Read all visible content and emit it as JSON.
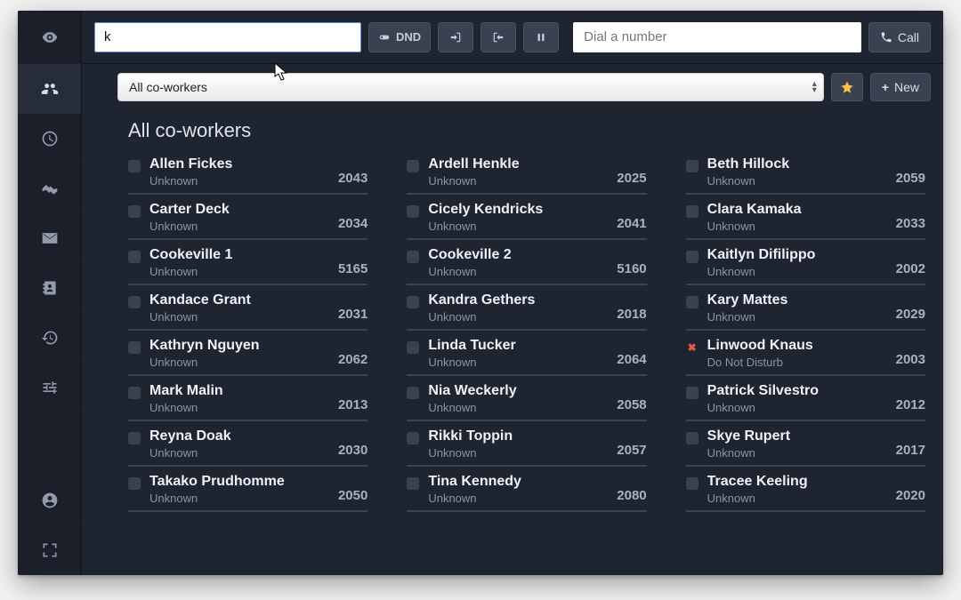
{
  "topbar": {
    "search_value": "k",
    "dnd_label": "DND",
    "dial_placeholder": "Dial a number",
    "call_label": "Call"
  },
  "filter": {
    "selected": "All co-workers",
    "new_label": "New"
  },
  "section": {
    "title": "All co-workers"
  },
  "status_labels": {
    "unknown": "Unknown",
    "dnd": "Do Not Disturb"
  },
  "contacts": [
    {
      "name": "Allen Fickes",
      "status": "unknown",
      "ext": "2043",
      "presence": "box"
    },
    {
      "name": "Ardell Henkle",
      "status": "unknown",
      "ext": "2025",
      "presence": "box"
    },
    {
      "name": "Beth Hillock",
      "status": "unknown",
      "ext": "2059",
      "presence": "box"
    },
    {
      "name": "Carter Deck",
      "status": "unknown",
      "ext": "2034",
      "presence": "box"
    },
    {
      "name": "Cicely Kendricks",
      "status": "unknown",
      "ext": "2041",
      "presence": "box"
    },
    {
      "name": "Clara Kamaka",
      "status": "unknown",
      "ext": "2033",
      "presence": "box"
    },
    {
      "name": "Cookeville 1",
      "status": "unknown",
      "ext": "5165",
      "presence": "box"
    },
    {
      "name": "Cookeville 2",
      "status": "unknown",
      "ext": "5160",
      "presence": "box"
    },
    {
      "name": "Kaitlyn Difilippo",
      "status": "unknown",
      "ext": "2002",
      "presence": "box"
    },
    {
      "name": "Kandace Grant",
      "status": "unknown",
      "ext": "2031",
      "presence": "box"
    },
    {
      "name": "Kandra Gethers",
      "status": "unknown",
      "ext": "2018",
      "presence": "box"
    },
    {
      "name": "Kary Mattes",
      "status": "unknown",
      "ext": "2029",
      "presence": "box"
    },
    {
      "name": "Kathryn Nguyen",
      "status": "unknown",
      "ext": "2062",
      "presence": "box"
    },
    {
      "name": "Linda Tucker",
      "status": "unknown",
      "ext": "2064",
      "presence": "box"
    },
    {
      "name": "Linwood Knaus",
      "status": "dnd",
      "ext": "2003",
      "presence": "dnd"
    },
    {
      "name": "Mark Malin",
      "status": "unknown",
      "ext": "2013",
      "presence": "box"
    },
    {
      "name": "Nia Weckerly",
      "status": "unknown",
      "ext": "2058",
      "presence": "box"
    },
    {
      "name": "Patrick Silvestro",
      "status": "unknown",
      "ext": "2012",
      "presence": "box"
    },
    {
      "name": "Reyna Doak",
      "status": "unknown",
      "ext": "2030",
      "presence": "box"
    },
    {
      "name": "Rikki Toppin",
      "status": "unknown",
      "ext": "2057",
      "presence": "box"
    },
    {
      "name": "Skye Rupert",
      "status": "unknown",
      "ext": "2017",
      "presence": "box"
    },
    {
      "name": "Takako Prudhomme",
      "status": "unknown",
      "ext": "2050",
      "presence": "box"
    },
    {
      "name": "Tina Kennedy",
      "status": "unknown",
      "ext": "2080",
      "presence": "box"
    },
    {
      "name": "Tracee Keeling",
      "status": "unknown",
      "ext": "2020",
      "presence": "box"
    }
  ]
}
